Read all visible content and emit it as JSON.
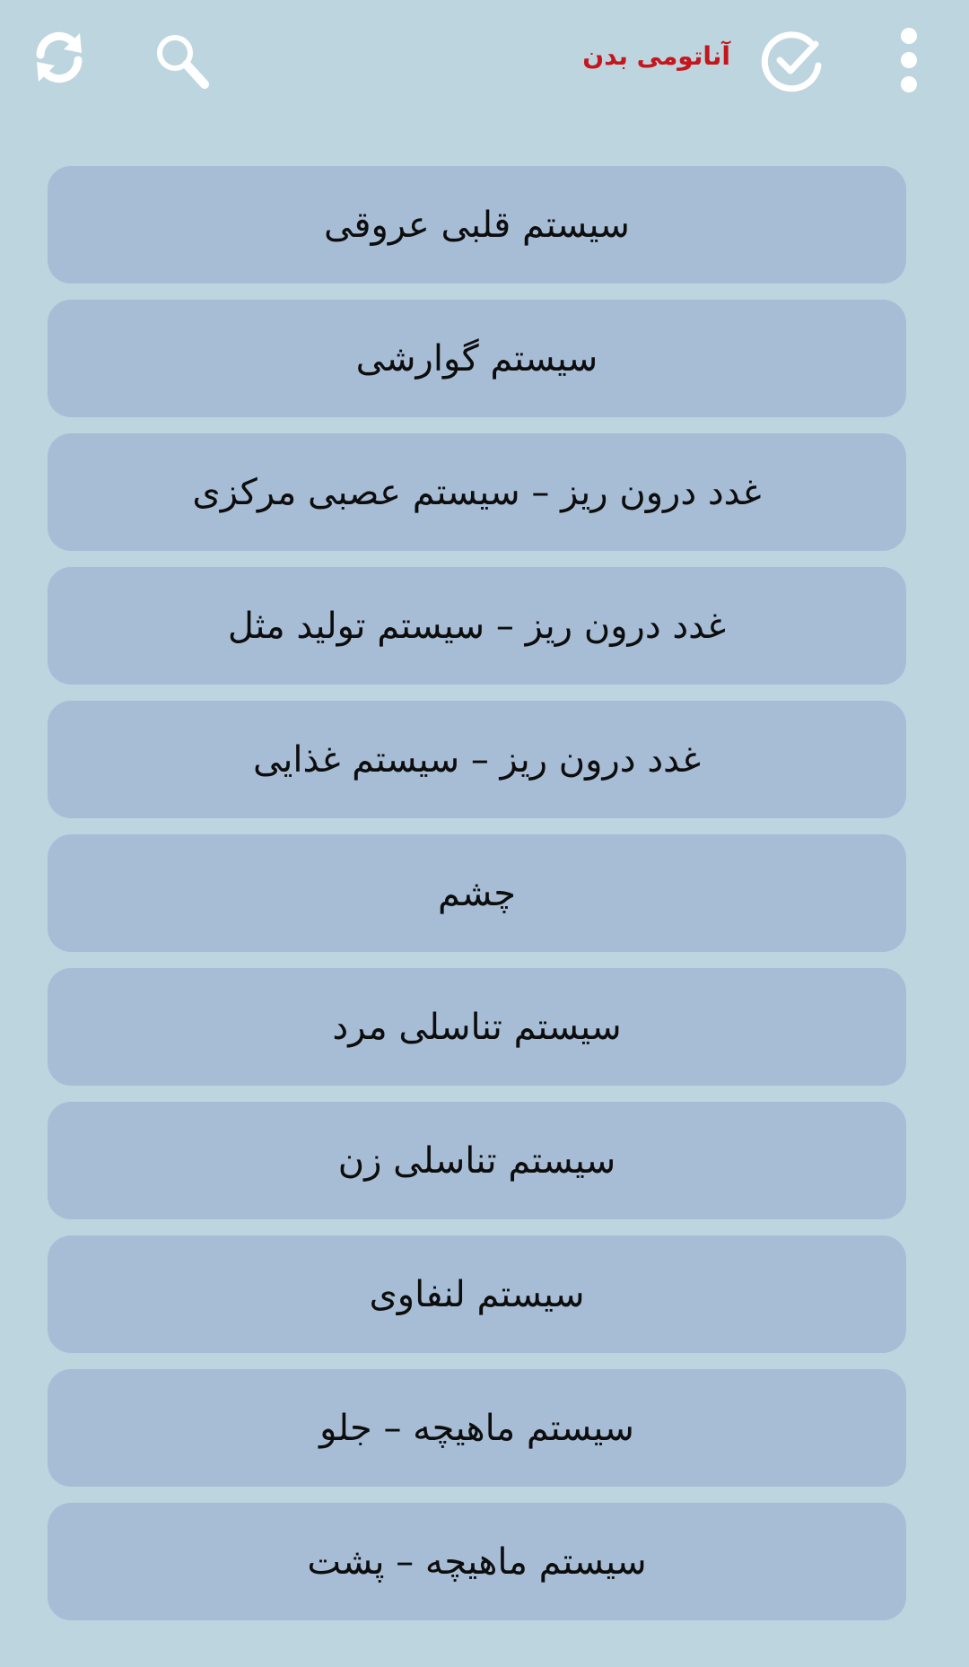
{
  "app_bar": {
    "title": "آناتومی بدن",
    "title_color": "#c4161c",
    "icons": {
      "refresh": "refresh-icon",
      "search": "search-icon",
      "check": "check-circle-icon",
      "menu": "more-vert-icon"
    }
  },
  "colors": {
    "background": "#bdd5df",
    "item_background": "#a7bdd5",
    "item_text": "#0d0d0d"
  },
  "list": {
    "items": [
      {
        "label": "سیستم قلبی عروقی"
      },
      {
        "label": "سیستم گوارشی"
      },
      {
        "label": "غدد درون ریز – سیستم عصبی مرکزی"
      },
      {
        "label": "غدد درون ریز – سیستم تولید مثل"
      },
      {
        "label": "غدد درون ریز – سیستم غذایی"
      },
      {
        "label": "چشم"
      },
      {
        "label": "سیستم تناسلی مرد"
      },
      {
        "label": "سیستم تناسلی زن"
      },
      {
        "label": "سیستم لنفاوی"
      },
      {
        "label": "سیستم ماهیچه – جلو"
      },
      {
        "label": "سیستم ماهیچه – پشت"
      }
    ]
  }
}
